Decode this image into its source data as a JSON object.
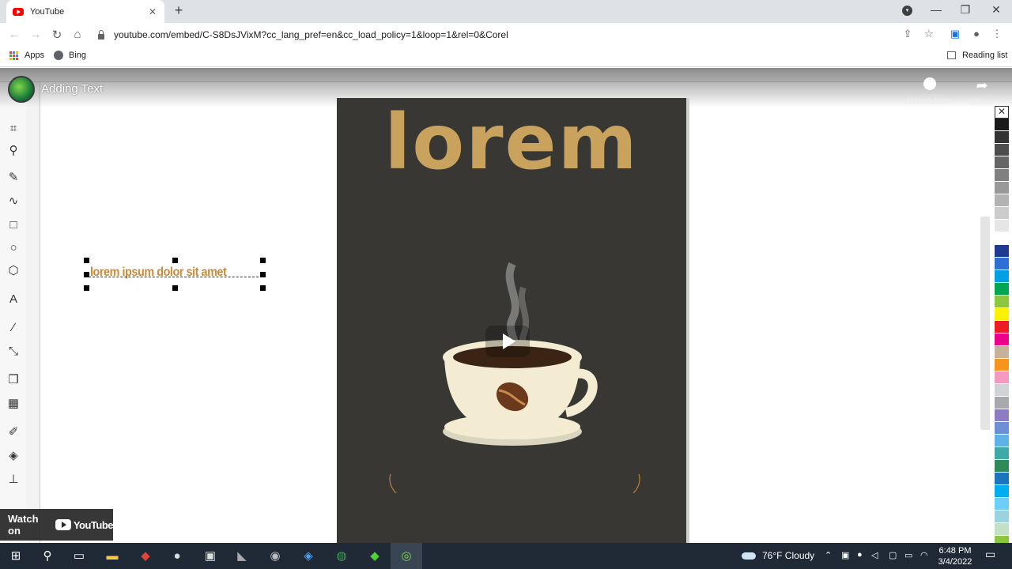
{
  "browser": {
    "tab": {
      "title": "YouTube",
      "close_icon": "close-icon",
      "favicon": "youtube-favicon"
    },
    "new_tab_label": "+",
    "window_controls": {
      "minimize": "—",
      "restore": "❐",
      "close": "✕"
    },
    "address": "youtube.com/embed/C-S8DsJVixM?cc_lang_pref=en&cc_load_policy=1&loop=1&rel=0&Corel",
    "bookmarks": {
      "apps": "Apps",
      "bing": "Bing",
      "reading_list": "Reading list"
    }
  },
  "video": {
    "title": "Adding Text",
    "watch_later": "Watch later",
    "share": "Share",
    "watch_on": "Watch on",
    "youtube_word": "YouTube",
    "canvas": {
      "headline": "lorem",
      "selected_text": "lorem ipsum dolor sit amet"
    },
    "palette_colors": [
      "#1a1a1a",
      "#333333",
      "#4d4d4d",
      "#666666",
      "#808080",
      "#999999",
      "#b3b3b3",
      "#cccccc",
      "#e6e6e6",
      "#ffffff",
      "#1f3a93",
      "#2e6fd6",
      "#00a0e3",
      "#00a651",
      "#8dc63f",
      "#fff200",
      "#ed1c24",
      "#ec008c",
      "#c7b299",
      "#f7941d",
      "#f49ac1",
      "#d1d3d4",
      "#a7a9ac",
      "#8e7cc3",
      "#6d8fd6",
      "#5fb3e4",
      "#3fa9a5",
      "#2e8b57",
      "#1b75bc",
      "#00aeef",
      "#6dcff6",
      "#9ad3de",
      "#c2e0c6",
      "#8cc63f",
      "#a0d468"
    ]
  },
  "taskbar": {
    "weather": "76°F  Cloudy",
    "time": "6:48 PM",
    "date": "3/4/2022"
  }
}
